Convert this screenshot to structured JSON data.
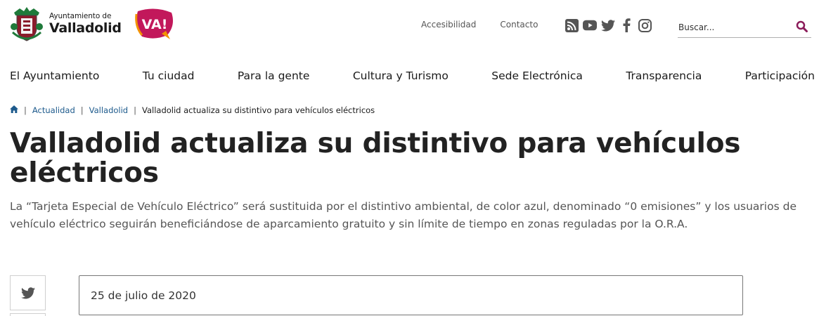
{
  "header": {
    "org_small": "Ayuntamiento de",
    "org_big": "Valladolid",
    "va_logo_text": "VA!",
    "top_links": [
      "Accesibilidad",
      "Contacto"
    ],
    "social_icons": [
      "rss-icon",
      "youtube-icon",
      "twitter-icon",
      "facebook-icon",
      "instagram-icon"
    ],
    "search_placeholder": "Buscar...",
    "colors": {
      "va_magenta": "#c2185b",
      "va_orange": "#f39200",
      "search_icon": "#8b1c5a",
      "link_blue": "#1d5a8c"
    }
  },
  "nav": {
    "items": [
      "El Ayuntamiento",
      "Tu ciudad",
      "Para la gente",
      "Cultura y Turismo",
      "Sede Electrónica",
      "Transparencia",
      "Participación"
    ]
  },
  "breadcrumb": {
    "home_icon": "home-icon",
    "items": [
      "Actualidad",
      "Valladolid"
    ],
    "current": "Valladolid actualiza su distintivo para vehículos eléctricos"
  },
  "article": {
    "title": "Valladolid actualiza su distintivo para vehículos eléctricos",
    "lead": "La “Tarjeta Especial de Vehículo Eléctrico” será sustituida por el distintivo ambiental, de color azul, denominado “0 emisiones” y los usuarios de vehículo eléctrico seguirán beneficiándose de aparcamiento gratuito y sin límite de tiempo en zonas reguladas por la O.R.A.",
    "date": "25 de julio de 2020"
  }
}
